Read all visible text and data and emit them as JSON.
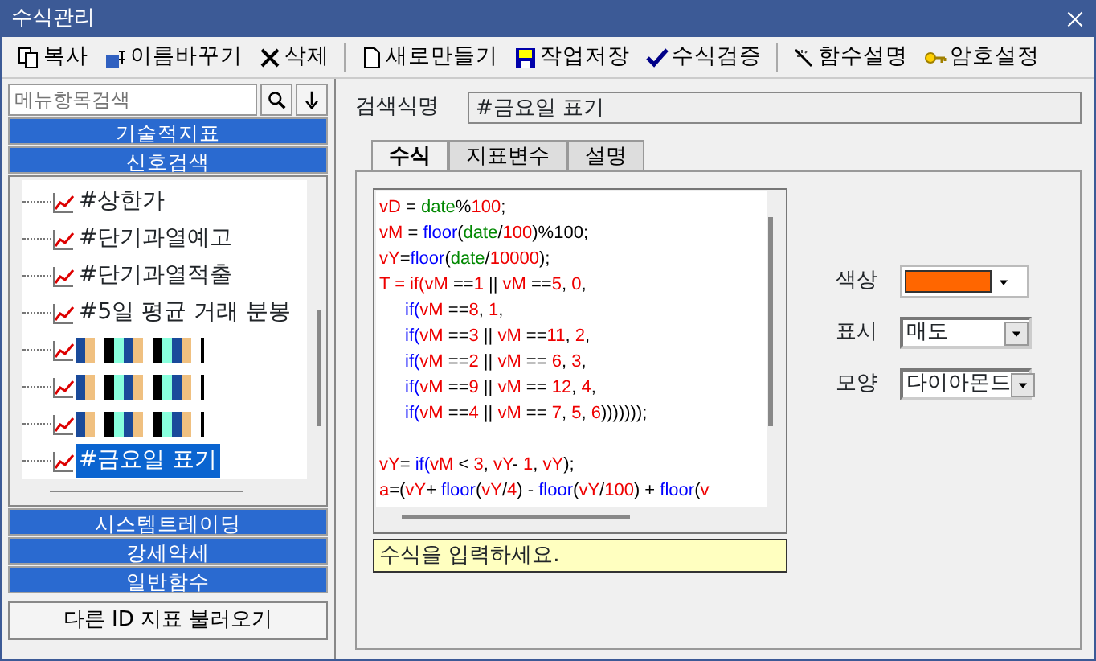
{
  "window": {
    "title": "수식관리"
  },
  "toolbar": [
    {
      "label": "복사"
    },
    {
      "label": "이름바꾸기"
    },
    {
      "label": "삭제"
    },
    {
      "label": "새로만들기"
    },
    {
      "label": "작업저장"
    },
    {
      "label": "수식검증"
    },
    {
      "label": "함수설명"
    },
    {
      "label": "암호설정"
    }
  ],
  "sidebar": {
    "search": {
      "placeholder": "메뉴항목검색"
    },
    "groups_top": [
      "기술적지표",
      "신호검색"
    ],
    "items": [
      {
        "kind": "text",
        "label": "#상한가",
        "selected": false
      },
      {
        "kind": "text",
        "label": "#단기과열예고",
        "selected": false
      },
      {
        "kind": "text",
        "label": "#단기과열적출",
        "selected": false
      },
      {
        "kind": "text",
        "label": "#5일 평균 거래 분봉",
        "selected": false
      },
      {
        "kind": "redacted",
        "selected": false
      },
      {
        "kind": "redacted",
        "selected": false
      },
      {
        "kind": "redacted",
        "selected": false
      },
      {
        "kind": "text",
        "label": "#금요일 표기",
        "selected": true
      }
    ],
    "groups_bottom": [
      "시스템트레이딩",
      "강세약세",
      "일반함수"
    ],
    "load_button": "다른 ID 지표 불러오기"
  },
  "name_field": {
    "label": "검색식명",
    "value": "#금요일 표기"
  },
  "tabs": [
    {
      "label": "수식",
      "selected": true
    },
    {
      "label": "지표변수",
      "selected": false
    },
    {
      "label": "설명",
      "selected": false
    }
  ],
  "code_lines": [
    {
      "indented": false,
      "space_before": false,
      "tokens": [
        {
          "kind": "var",
          "text": "vD"
        },
        {
          "kind": "op",
          "text": " = "
        },
        {
          "kind": "field",
          "text": "date"
        },
        {
          "kind": "op",
          "text": "%"
        },
        {
          "kind": "num",
          "text": "100"
        },
        {
          "kind": "op",
          "text": ";"
        }
      ]
    },
    {
      "indented": false,
      "space_before": false,
      "tokens": [
        {
          "kind": "var",
          "text": "vM"
        },
        {
          "kind": "op",
          "text": " = "
        },
        {
          "kind": "fn",
          "text": "floor"
        },
        {
          "kind": "op",
          "text": "("
        },
        {
          "kind": "field",
          "text": "date"
        },
        {
          "kind": "op",
          "text": "/"
        },
        {
          "kind": "num",
          "text": "100"
        },
        {
          "kind": "op",
          "text": ")%100;"
        }
      ]
    },
    {
      "indented": false,
      "space_before": false,
      "tokens": [
        {
          "kind": "var",
          "text": "vY"
        },
        {
          "kind": "op",
          "text": "="
        },
        {
          "kind": "fn",
          "text": "floor"
        },
        {
          "kind": "op",
          "text": "("
        },
        {
          "kind": "field",
          "text": "date"
        },
        {
          "kind": "op",
          "text": "/"
        },
        {
          "kind": "num",
          "text": "10000"
        },
        {
          "kind": "op",
          "text": ");"
        }
      ]
    },
    {
      "indented": false,
      "space_before": false,
      "tokens": [
        {
          "kind": "var",
          "text": "T = if("
        },
        {
          "kind": "var",
          "text": "vM"
        },
        {
          "kind": "op",
          "text": " =="
        },
        {
          "kind": "num",
          "text": "1"
        },
        {
          "kind": "op",
          "text": " || "
        },
        {
          "kind": "var",
          "text": "vM"
        },
        {
          "kind": "op",
          "text": " =="
        },
        {
          "kind": "num",
          "text": "5"
        },
        {
          "kind": "op",
          "text": ", "
        },
        {
          "kind": "num",
          "text": "0"
        },
        {
          "kind": "op",
          "text": ","
        }
      ]
    },
    {
      "indented": true,
      "space_before": false,
      "tokens": [
        {
          "kind": "fn",
          "text": "if("
        },
        {
          "kind": "var",
          "text": "vM"
        },
        {
          "kind": "op",
          "text": " =="
        },
        {
          "kind": "num",
          "text": "8"
        },
        {
          "kind": "op",
          "text": ", "
        },
        {
          "kind": "num",
          "text": "1"
        },
        {
          "kind": "op",
          "text": ","
        }
      ]
    },
    {
      "indented": true,
      "space_before": false,
      "tokens": [
        {
          "kind": "fn",
          "text": "if("
        },
        {
          "kind": "var",
          "text": "vM"
        },
        {
          "kind": "op",
          "text": " =="
        },
        {
          "kind": "num",
          "text": "3"
        },
        {
          "kind": "op",
          "text": " || "
        },
        {
          "kind": "var",
          "text": "vM"
        },
        {
          "kind": "op",
          "text": " =="
        },
        {
          "kind": "num",
          "text": "11"
        },
        {
          "kind": "op",
          "text": ", "
        },
        {
          "kind": "num",
          "text": "2"
        },
        {
          "kind": "op",
          "text": ","
        }
      ]
    },
    {
      "indented": true,
      "space_before": false,
      "tokens": [
        {
          "kind": "fn",
          "text": "if("
        },
        {
          "kind": "var",
          "text": "vM"
        },
        {
          "kind": "op",
          "text": " =="
        },
        {
          "kind": "num",
          "text": "2"
        },
        {
          "kind": "op",
          "text": " || "
        },
        {
          "kind": "var",
          "text": "vM"
        },
        {
          "kind": "op",
          "text": " == "
        },
        {
          "kind": "num",
          "text": "6"
        },
        {
          "kind": "op",
          "text": ", "
        },
        {
          "kind": "num",
          "text": "3"
        },
        {
          "kind": "op",
          "text": ","
        }
      ]
    },
    {
      "indented": true,
      "space_before": false,
      "tokens": [
        {
          "kind": "fn",
          "text": "if("
        },
        {
          "kind": "var",
          "text": "vM"
        },
        {
          "kind": "op",
          "text": " =="
        },
        {
          "kind": "num",
          "text": "9"
        },
        {
          "kind": "op",
          "text": " || "
        },
        {
          "kind": "var",
          "text": "vM"
        },
        {
          "kind": "op",
          "text": " == "
        },
        {
          "kind": "num",
          "text": "12"
        },
        {
          "kind": "op",
          "text": ", "
        },
        {
          "kind": "num",
          "text": "4"
        },
        {
          "kind": "op",
          "text": ","
        }
      ]
    },
    {
      "indented": true,
      "space_before": false,
      "tokens": [
        {
          "kind": "fn",
          "text": "if("
        },
        {
          "kind": "var",
          "text": "vM"
        },
        {
          "kind": "op",
          "text": " =="
        },
        {
          "kind": "num",
          "text": "4"
        },
        {
          "kind": "op",
          "text": " || "
        },
        {
          "kind": "var",
          "text": "vM"
        },
        {
          "kind": "op",
          "text": " == "
        },
        {
          "kind": "num",
          "text": "7"
        },
        {
          "kind": "op",
          "text": ", "
        },
        {
          "kind": "num",
          "text": "5"
        },
        {
          "kind": "op",
          "text": ", "
        },
        {
          "kind": "num",
          "text": "6"
        },
        {
          "kind": "op",
          "text": ")))))));"
        }
      ]
    },
    {
      "indented": false,
      "space_before": true,
      "tokens": [
        {
          "kind": "var",
          "text": "vY"
        },
        {
          "kind": "op",
          "text": "= "
        },
        {
          "kind": "fn",
          "text": "if("
        },
        {
          "kind": "var",
          "text": "vM"
        },
        {
          "kind": "op",
          "text": " < "
        },
        {
          "kind": "num",
          "text": "3"
        },
        {
          "kind": "op",
          "text": ", "
        },
        {
          "kind": "var",
          "text": "vY"
        },
        {
          "kind": "op",
          "text": "- "
        },
        {
          "kind": "num",
          "text": "1"
        },
        {
          "kind": "op",
          "text": ", "
        },
        {
          "kind": "var",
          "text": "vY"
        },
        {
          "kind": "op",
          "text": ");"
        }
      ]
    },
    {
      "indented": false,
      "space_before": false,
      "tokens": [
        {
          "kind": "var",
          "text": "a"
        },
        {
          "kind": "op",
          "text": "=("
        },
        {
          "kind": "var",
          "text": "vY"
        },
        {
          "kind": "op",
          "text": "+ "
        },
        {
          "kind": "fn",
          "text": "floor"
        },
        {
          "kind": "op",
          "text": "("
        },
        {
          "kind": "var",
          "text": "vY"
        },
        {
          "kind": "op",
          "text": "/"
        },
        {
          "kind": "num",
          "text": "4"
        },
        {
          "kind": "op",
          "text": ") - "
        },
        {
          "kind": "fn",
          "text": "floor"
        },
        {
          "kind": "op",
          "text": "("
        },
        {
          "kind": "var",
          "text": "vY"
        },
        {
          "kind": "op",
          "text": "/"
        },
        {
          "kind": "num",
          "text": "100"
        },
        {
          "kind": "op",
          "text": ") + "
        },
        {
          "kind": "fn",
          "text": "floor"
        },
        {
          "kind": "op",
          "text": "("
        },
        {
          "kind": "var",
          "text": "v"
        }
      ]
    }
  ],
  "hint": "수식을 입력하세요.",
  "properties": [
    {
      "kind": "color",
      "label": "색상",
      "color": "#ff6600"
    },
    {
      "kind": "select",
      "label": "표시",
      "value": "매도"
    },
    {
      "kind": "select",
      "label": "모양",
      "value": "다이아몬드"
    }
  ]
}
